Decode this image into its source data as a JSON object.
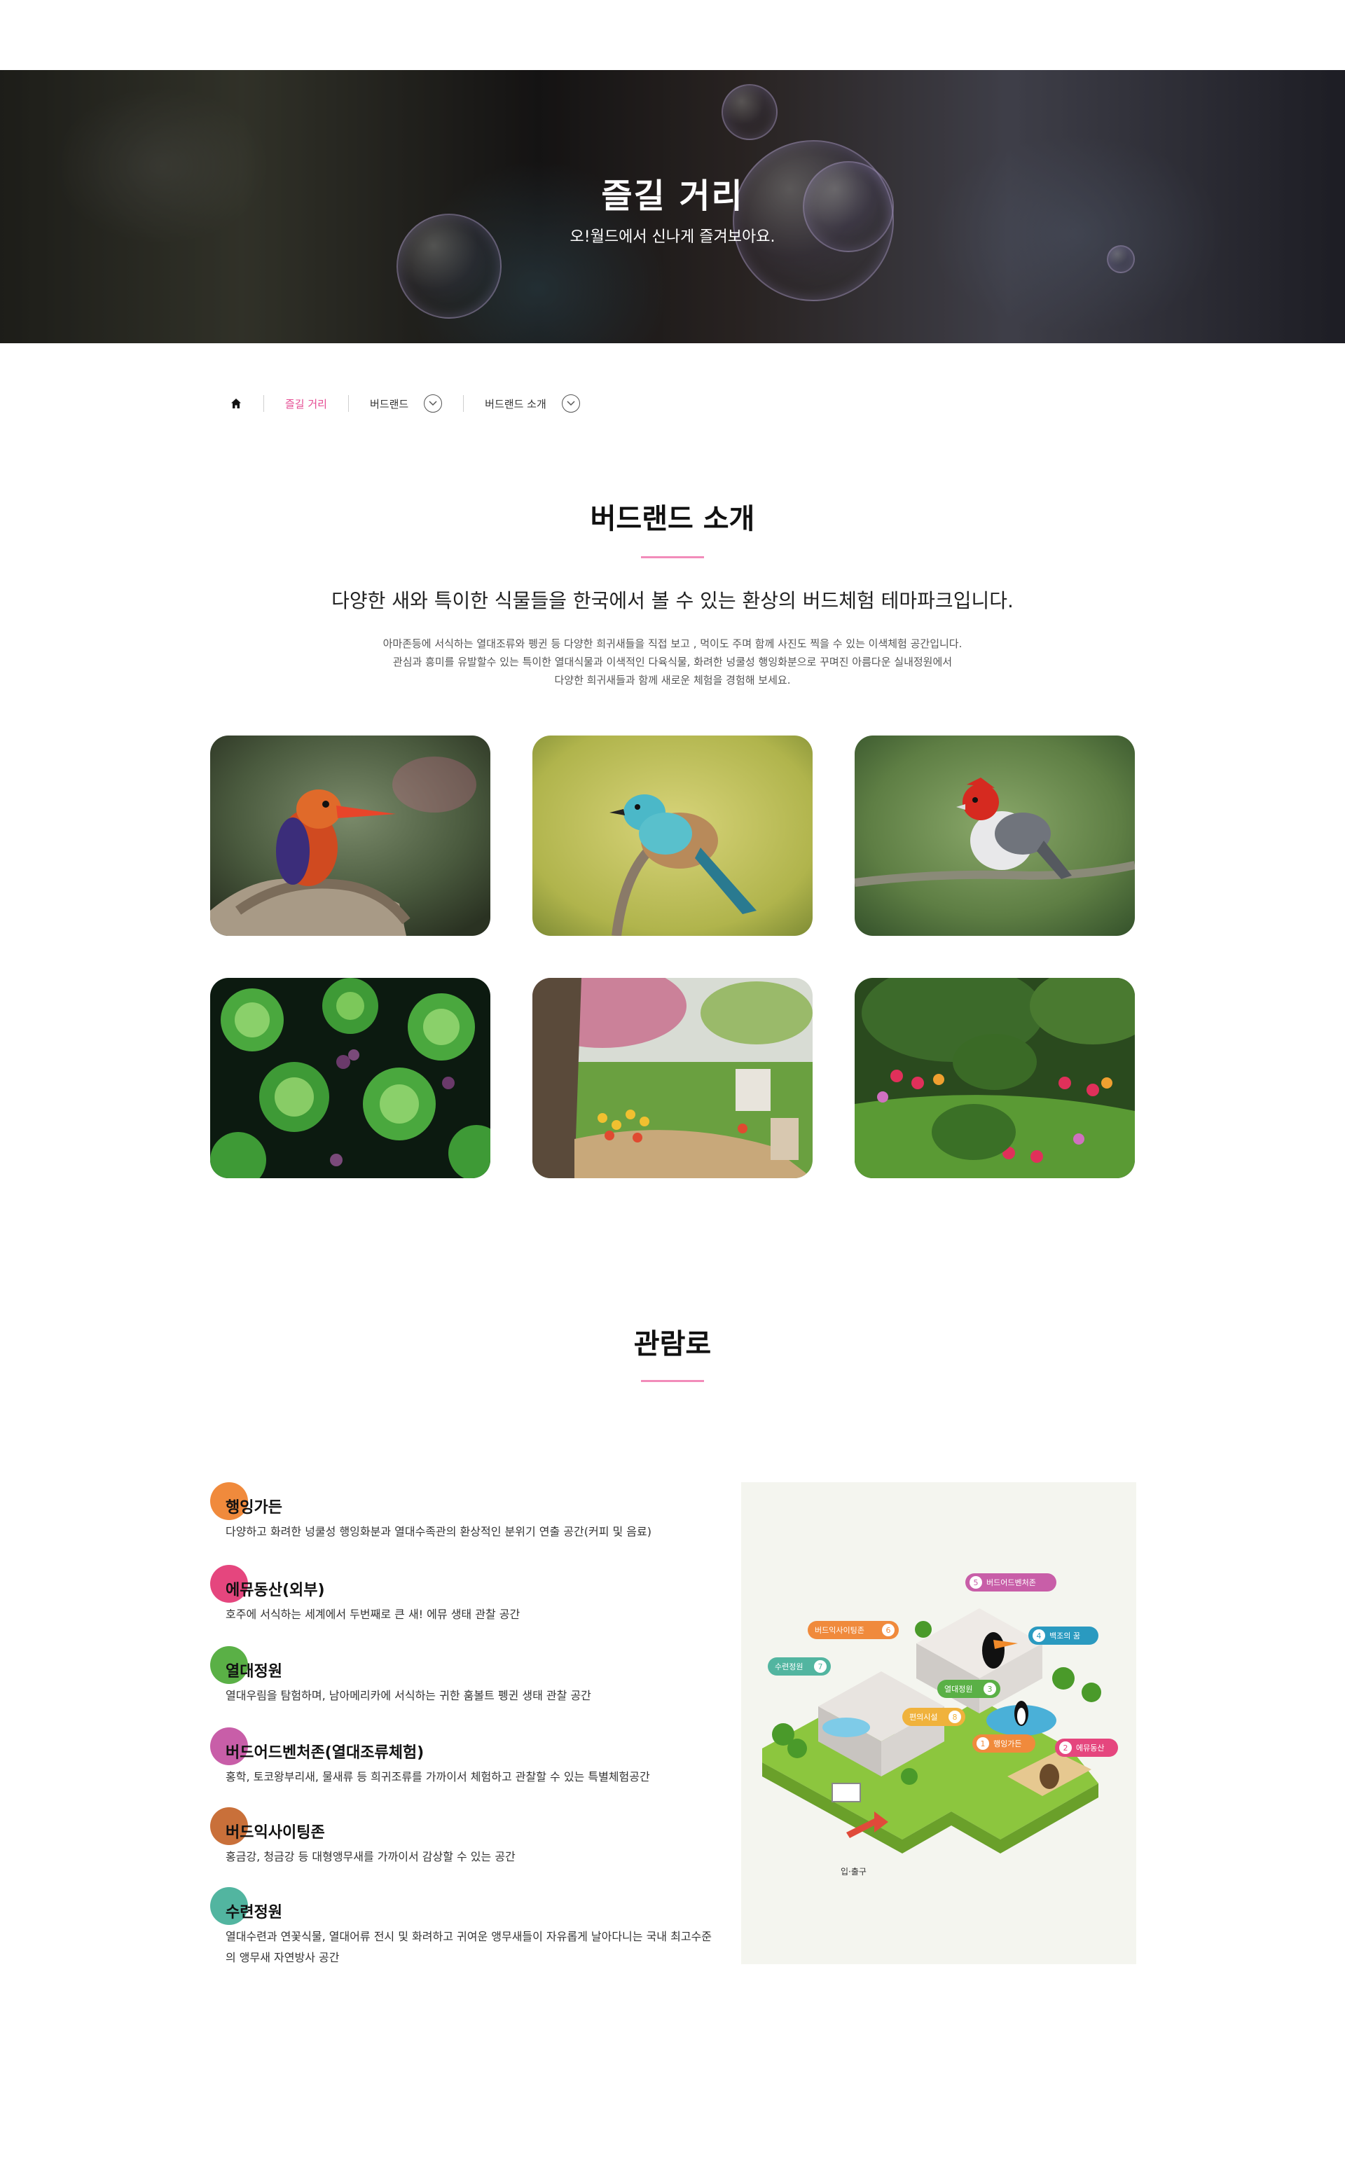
{
  "hero": {
    "title": "즐길 거리",
    "subtitle": "오!월드에서 신나게 즐겨보아요."
  },
  "breadcrumb": {
    "home_icon": "home-icon",
    "items": [
      {
        "label": "즐길 거리",
        "active": true
      },
      {
        "label": "버드랜드",
        "has_dropdown": true
      },
      {
        "label": "버드랜드 소개",
        "has_dropdown": true
      }
    ]
  },
  "intro": {
    "title": "버드랜드 소개",
    "lead": "다양한 새와 특이한 식물들을 한국에서 볼 수 있는 환상의 버드체험 테마파크입니다.",
    "desc_lines": [
      "아마존등에 서식하는 열대조류와 펭귄 등 다양한 희귀새들을 직접 보고 , 먹이도 주며 함께 사진도 찍을 수 있는 이색체험 공간입니다.",
      "관심과 흥미를 유발할수 있는 특이한 열대식물과 이색적인 다육식물, 화려한 넝쿨성 행잉화분으로 꾸며진 아름다운 실내정원에서",
      "다양한 희귀새들과 함께 새로운 체험을 경험해 보세요."
    ]
  },
  "gallery": [
    {
      "subject": "kingfisher"
    },
    {
      "subject": "roller-bird"
    },
    {
      "subject": "red-crested-cardinal"
    },
    {
      "subject": "succulent-plants"
    },
    {
      "subject": "tulip-garden"
    },
    {
      "subject": "flower-garden"
    }
  ],
  "route": {
    "title": "관람로",
    "items": [
      {
        "name": "행잉가든",
        "desc": "다양하고 화려한 넝쿨성 행잉화분과 열대수족관의 환상적인 분위기 연출 공간(커피 및 음료)",
        "color": "#f08a3c"
      },
      {
        "name": "에뮤동산(외부)",
        "desc": "호주에 서식하는 세계에서 두번째로 큰 새! 에뮤 생태 관찰 공간",
        "color": "#e5467e"
      },
      {
        "name": "열대정원",
        "desc": "열대우림을 탐험하며, 남아메리카에 서식하는 귀한 훔볼트 펭귄 생태 관찰 공간",
        "color": "#5ab046"
      },
      {
        "name": "버드어드벤처존(열대조류체험)",
        "desc": "홍학, 토코왕부리새, 물새류 등 희귀조류를 가까이서 체험하고 관찰할 수 있는 특별체험공간",
        "color": "#c85ea8"
      },
      {
        "name": "버드익사이팅존",
        "desc": "홍금강, 청금강 등 대형앵무새를 가까이서 감상할 수 있는 공간",
        "color": "#c9703a"
      },
      {
        "name": "수련정원",
        "desc": "열대수련과 연꽃식물, 열대어류 전시 및 화려하고 귀여운 앵무새들이 자유롭게 날아다니는 국내 최고수준의 앵무새 자연방사 공간",
        "color": "#52b5a0"
      }
    ]
  },
  "map": {
    "labels": [
      {
        "num": "1",
        "name": "행잉가든",
        "color": "#f08a3c"
      },
      {
        "num": "2",
        "name": "에뮤동산",
        "color": "#e5467e"
      },
      {
        "num": "3",
        "name": "열대정원",
        "color": "#5ab046"
      },
      {
        "num": "4",
        "name": "백조의 꿈",
        "color": "#2a9ac0"
      },
      {
        "num": "5",
        "name": "버드어드벤처존",
        "color": "#c85ea8"
      },
      {
        "num": "6",
        "name": "버드익사이팅존",
        "color": "#f08a3c"
      },
      {
        "num": "7",
        "name": "수련정원",
        "color": "#52b5a0"
      },
      {
        "num": "8",
        "name": "편의시설",
        "color": "#f0b23c"
      }
    ],
    "entrance": "입·출구"
  }
}
